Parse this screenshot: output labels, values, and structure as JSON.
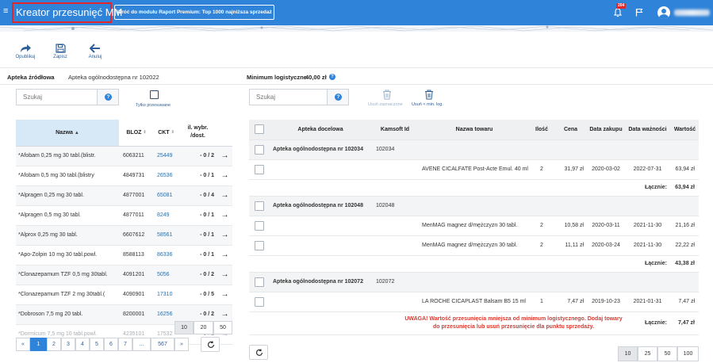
{
  "header": {
    "title": "Kreator przesunięć MM",
    "back_button": "Wróć do modułu Raport Premium: Top 1000 najniższa sprzedaż",
    "notif_count": "204"
  },
  "toolbar": {
    "publish": "Opublikuj",
    "save": "Zapisz",
    "cancel": "Anuluj"
  },
  "source": {
    "label": "Apteka źródłowa",
    "value": "Apteka ogólnodostępna nr 102022",
    "min_label": "Minimum logistyczne",
    "min_value": "40,00 zł"
  },
  "left": {
    "search_placeholder": "Szukaj",
    "only_moved": "Tylko przesuwane",
    "columns": {
      "name": "Nazwa",
      "bloz": "BLOZ",
      "ckt": "CKT",
      "qty1": "il. wybr.",
      "qty2": "/dost."
    },
    "rows": [
      {
        "name": "*Afobam 0,25 mg 30 tabl.(blistr.",
        "bloz": "6063211",
        "ckt": "25449",
        "qty": "- 0 / 2",
        "arrow": "→"
      },
      {
        "name": "*Afobam 0,5 mg 30 tabl.(blistry",
        "bloz": "4849731",
        "ckt": "26536",
        "qty": "- 0 / 1",
        "arrow": "→"
      },
      {
        "name": "*Alpragen 0,25 mg 30 tabl.",
        "bloz": "4877001",
        "ckt": "65081",
        "qty": "- 0 / 4",
        "arrow": "→"
      },
      {
        "name": "*Alpragen 0,5 mg 30 tabl.",
        "bloz": "4877011",
        "ckt": "8249",
        "qty": "- 0 / 1",
        "arrow": "→"
      },
      {
        "name": "*Alprox 0,25 mg 30 tabl.",
        "bloz": "6607612",
        "ckt": "58561",
        "qty": "- 0 / 1",
        "arrow": "→"
      },
      {
        "name": "*Apo-Zolpin 10 mg 30 tabl.powl.",
        "bloz": "8588113",
        "ckt": "86336",
        "qty": "- 0 / 1",
        "arrow": "→"
      },
      {
        "name": "*Clonazepamum TZF 0,5 mg 30tabl.",
        "bloz": "4091201",
        "ckt": "5056",
        "qty": "- 0 / 2",
        "arrow": "→"
      },
      {
        "name": "*Clonazepamum TZF 2 mg 30tabl.(",
        "bloz": "4090901",
        "ckt": "17310",
        "qty": "- 0 / 5",
        "arrow": "→"
      },
      {
        "name": "*Dobroson 7,5 mg 20 tabl.",
        "bloz": "8200001",
        "ckt": "16256",
        "qty": "- 0 / 2",
        "arrow": "→"
      },
      {
        "name": "*Dormicum 7,5 mg 10 tabl.powl.",
        "bloz": "4235101",
        "ckt": "17532",
        "qty": "- 0 / 2",
        "arrow": "→"
      }
    ],
    "page_sizes": [
      "10",
      "20",
      "50"
    ],
    "pages": [
      "«",
      "1",
      "2",
      "3",
      "4",
      "5",
      "6",
      "7",
      "...",
      "567",
      "»"
    ]
  },
  "right": {
    "search_placeholder": "Szukaj",
    "remove_selected": "Usuń zaznaczone",
    "remove_min": "Usuń < min. log.",
    "columns": {
      "target": "Apteka docelowa",
      "kamsoft": "Kamsoft Id",
      "product": "Nazwa towaru",
      "qty": "Ilość",
      "price": "Cena",
      "purchase": "Data zakupu",
      "expiry": "Data ważności",
      "value": "Wartość"
    },
    "sum_label": "Łącznie:",
    "groups": [
      {
        "name": "Apteka ogólnodostępna nr 102034",
        "kamsoft": "102034",
        "items": [
          {
            "product": "AVENE CICALFATE Post-Acte Emul. 40 ml",
            "qty": "2",
            "price": "31,97 zł",
            "purchase": "2020-03-02",
            "expiry": "2022-07-31",
            "value": "63,94 zł"
          }
        ],
        "total": "63,94 zł"
      },
      {
        "name": "Apteka ogólnodostępna nr 102048",
        "kamsoft": "102048",
        "items": [
          {
            "product": "MenMAG magnez d/mężczyzn 30 tabl.",
            "qty": "2",
            "price": "10,58 zł",
            "purchase": "2020-03-11",
            "expiry": "2021-11-30",
            "value": "21,16 zł"
          },
          {
            "product": "MenMAG magnez d/mężczyzn 30 tabl.",
            "qty": "2",
            "price": "11,11 zł",
            "purchase": "2020-03-24",
            "expiry": "2021-11-30",
            "value": "22,22 zł"
          }
        ],
        "total": "43,38 zł"
      },
      {
        "name": "Apteka ogólnodostępna nr 102072",
        "kamsoft": "102072",
        "items": [
          {
            "product": "LA ROCHE CICAPLAST Balsam B5 15 ml",
            "qty": "1",
            "price": "7,47 zł",
            "purchase": "2019-10-23",
            "expiry": "2021-01-31",
            "value": "7,47 zł"
          }
        ],
        "total": "7,47 zł",
        "warning": "UWAGA! Wartość przesunięcia mniejsza od minimum logistycznego. Dodaj towary do przesunięcia lub usuń przesunięcie dla punktu sprzedaży."
      }
    ],
    "page_sizes": [
      "10",
      "25",
      "50",
      "100"
    ]
  },
  "colors": {
    "primary": "#2f83d9",
    "alert": "#e3262b",
    "warning_text": "#d9392f"
  }
}
